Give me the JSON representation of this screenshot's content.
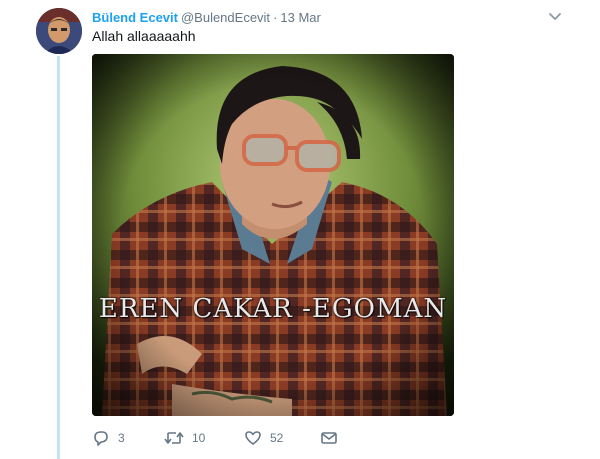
{
  "tweet": {
    "display_name": "Bülend Ecevit",
    "handle": "@BulendEcevit",
    "separator": "·",
    "date": "13 Mar",
    "text": "Allah allaaaaahh",
    "media": {
      "watermark": "EREN CAKAR -EGOMAN"
    },
    "actions": {
      "reply_count": "3",
      "retweet_count": "10",
      "like_count": "52"
    }
  },
  "icons": {
    "caret": "chevron-down-icon",
    "reply": "reply-icon",
    "retweet": "retweet-icon",
    "like": "heart-icon",
    "dm": "envelope-icon"
  },
  "colors": {
    "accent": "#1da1f2",
    "muted": "#657786",
    "text": "#14171a",
    "thread_line": "#c4e3f6"
  }
}
